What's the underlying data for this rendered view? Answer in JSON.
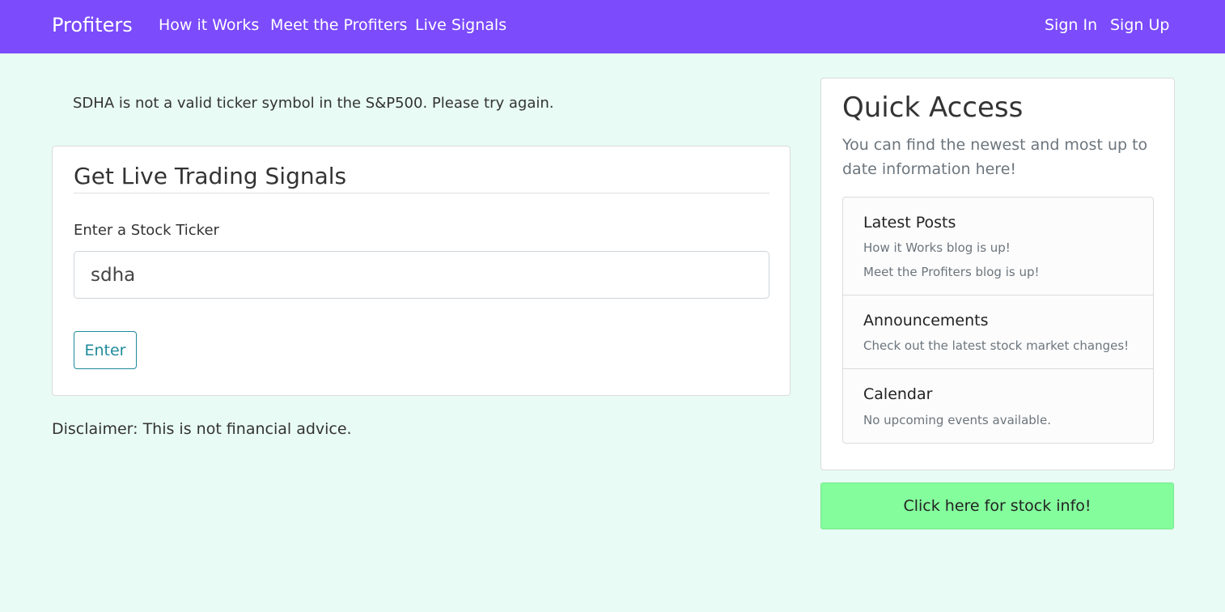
{
  "navbar": {
    "brand": "Profiters",
    "links": [
      "How it Works",
      "Meet the Profiters",
      "Live Signals"
    ],
    "sign_in": "Sign In",
    "sign_up": "Sign Up",
    "color": "#7b4bfc"
  },
  "alert": "SDHA is not a valid ticker symbol in the S&P500. Please try again.",
  "signals": {
    "title": "Get Live Trading Signals",
    "label": "Enter a Stock Ticker",
    "input_value": "sdha",
    "button": "Enter"
  },
  "disclaimer": "Disclaimer: This is not financial advice.",
  "quick_access": {
    "title": "Quick Access",
    "subtitle": "You can find the newest and most up to date information here!",
    "sections": [
      {
        "title": "Latest Posts",
        "lines": [
          "How it Works blog is up!",
          "Meet the Profiters blog is up!"
        ]
      },
      {
        "title": "Announcements",
        "lines": [
          "Check out the latest stock market changes!"
        ]
      },
      {
        "title": "Calendar",
        "lines": [
          "No upcoming events available."
        ]
      }
    ]
  },
  "stock_button": {
    "label": "Click here for stock info!",
    "color": "#84fd9c"
  },
  "colors": {
    "page_background": "#e8fbf4",
    "enter_accent": "#1f8a9a"
  }
}
